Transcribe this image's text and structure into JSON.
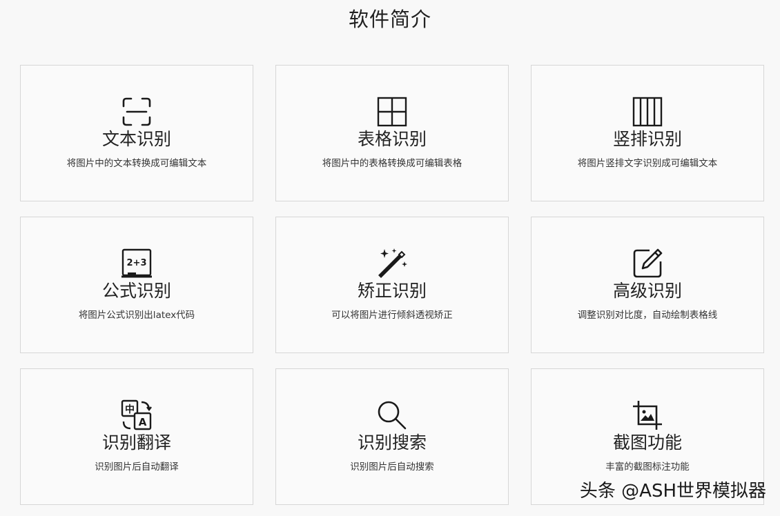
{
  "page": {
    "title": "软件简介"
  },
  "cards": [
    {
      "title": "文本识别",
      "desc": "将图片中的文本转换成可编辑文本",
      "icon": "text-scan-icon"
    },
    {
      "title": "表格识别",
      "desc": "将图片中的表格转换成可编辑表格",
      "icon": "table-grid-icon"
    },
    {
      "title": "竖排识别",
      "desc": "将图片竖排文字识别成可编辑文本",
      "icon": "vertical-columns-icon"
    },
    {
      "title": "公式识别",
      "desc": "将图片公式识别出latex代码",
      "icon": "formula-board-icon"
    },
    {
      "title": "矫正识别",
      "desc": "可以将图片进行倾斜透视矫正",
      "icon": "magic-wand-icon"
    },
    {
      "title": "高级识别",
      "desc": "调整识别对比度，自动绘制表格线",
      "icon": "edit-pencil-icon"
    },
    {
      "title": "识别翻译",
      "desc": "识别图片后自动翻译",
      "icon": "translate-icon"
    },
    {
      "title": "识别搜索",
      "desc": "识别图片后自动搜索",
      "icon": "search-icon"
    },
    {
      "title": "截图功能",
      "desc": "丰富的截图标注功能",
      "icon": "crop-image-icon"
    }
  ],
  "icon_text": {
    "formula": "2+3",
    "translate_zh": "中",
    "translate_en": "A"
  },
  "watermark": "头条 @ASH世界模拟器"
}
